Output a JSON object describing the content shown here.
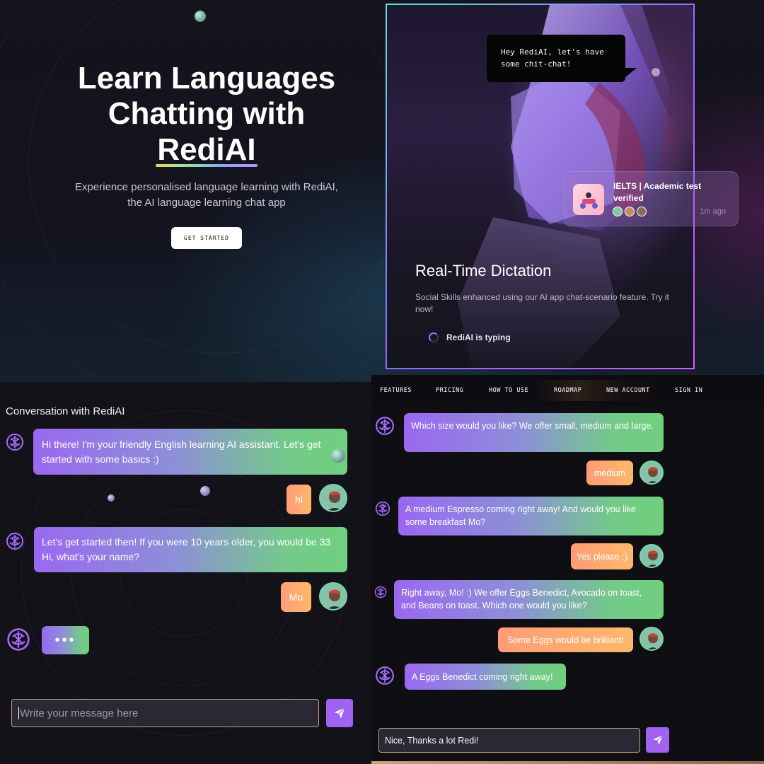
{
  "hero": {
    "title_line1": "Learn Languages",
    "title_line2": "Chatting with",
    "title_line3": "RediAI",
    "subtitle_line1": "Experience personalised language learning with RediAI,",
    "subtitle_line2": "the AI language learning chat app",
    "cta_label": "GET STARTED"
  },
  "feature_card": {
    "speech_bubble": "Hey RediAI, let's have some chit-chat!",
    "notification_title": "IELTS | Academic test verified",
    "notification_time": "1m ago",
    "heading": "Real-Time Dictation",
    "description": "Social Skills enhanced using our AI app chat-scenario feature. Try it now!",
    "typing_status": "RediAI is typing"
  },
  "chat_left": {
    "title": "Conversation with RediAI",
    "messages": [
      {
        "role": "bot",
        "text": "Hi there! I'm your friendly English learning AI assistant. Let's get started with some basics :)"
      },
      {
        "role": "user",
        "text": "hi"
      },
      {
        "role": "bot",
        "text": "Let's get started then! If you were 10 years older, you would be 33 Hi, what's your name?"
      },
      {
        "role": "user",
        "text": "Mo"
      },
      {
        "role": "bot",
        "text": "•••"
      }
    ],
    "composer_placeholder": "Write your message here"
  },
  "chat_right": {
    "nav": [
      "FEATURES",
      "PRICING",
      "HOW TO USE",
      "ROADMAP",
      "NEW ACCOUNT",
      "SIGN IN"
    ],
    "messages": [
      {
        "role": "bot",
        "text": "Which size would you like? We offer small, medium and large."
      },
      {
        "role": "user",
        "text": "medium"
      },
      {
        "role": "bot",
        "text": "A medium Espresso coming right away! And would you like some breakfast Mo?"
      },
      {
        "role": "user",
        "text": "Yes please :)"
      },
      {
        "role": "bot",
        "text": "Right away, Mo! :) We offer Eggs Benedict, Avocado on toast, and Beans on toast. Which one would you like?"
      },
      {
        "role": "user",
        "text": "Some Eggs would be brilliant!"
      },
      {
        "role": "bot",
        "text": "A Eggs Benedict coming right away!"
      }
    ],
    "composer_value": "Nice, Thanks a lot Redi!"
  },
  "colors": {
    "accent_purple": "#a063f0",
    "bot_gradient_start": "#9a68f0",
    "bot_gradient_end": "#6fd07e",
    "user_gradient_start": "#ff9c77",
    "user_gradient_end": "#ffb86a"
  },
  "icons": [
    "bot-brain-icon",
    "send-icon",
    "user-avatar",
    "spinner-icon"
  ]
}
